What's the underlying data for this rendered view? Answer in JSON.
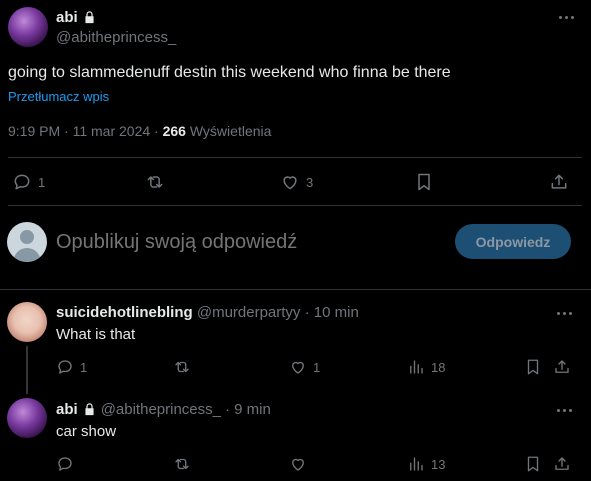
{
  "main_post": {
    "display_name": "abi",
    "handle": "@abitheprincess_",
    "text": "going to slammedenuff destin this weekend who finna be there",
    "translate_link": "Przetłumacz wpis",
    "timestamp": "9:19 PM · 11 mar 2024 · ",
    "views_count": "266",
    "views_label": " Wyświetlenia",
    "actions": {
      "replies": "1",
      "reposts": "",
      "likes": "3"
    }
  },
  "reply_composer": {
    "placeholder": "Opublikuj swoją odpowiedź",
    "button_label": "Odpowiedz"
  },
  "replies": [
    {
      "display_name": "suicidehotlinebling",
      "handle": "@murderpartyy",
      "time": "· 10 min",
      "text": "What is that",
      "actions": {
        "replies": "1",
        "reposts": "",
        "likes": "1",
        "views": "18"
      }
    },
    {
      "display_name": "abi",
      "handle": "@abitheprincess_",
      "time": "· 9 min",
      "text": "car show",
      "actions": {
        "replies": "",
        "reposts": "",
        "likes": "",
        "views": "13"
      }
    }
  ],
  "colors": {
    "background": "#000000",
    "text": "#e7e9ea",
    "secondary": "#71767b",
    "link": "#1d9bf0",
    "button_bg": "#1d4e73",
    "divider": "#2f3336"
  }
}
